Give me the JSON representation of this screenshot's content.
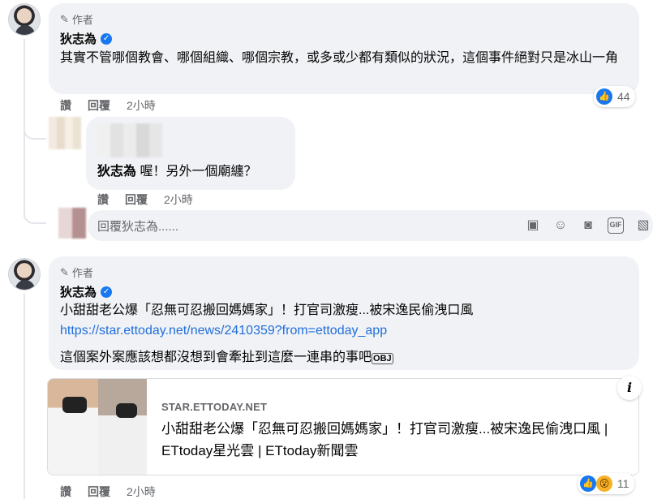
{
  "comment1": {
    "author_badge": "作者",
    "name": "狄志為",
    "text": "其實不管哪個教會、哪個組織、哪個宗教，或多或少都有類似的狀況，這個事件絕對只是冰山一角",
    "actions": {
      "like": "讚",
      "reply": "回覆",
      "time": "2小時"
    },
    "reaction_count": "44"
  },
  "reply1": {
    "mention": "狄志為",
    "text": "喔！另外一個廟纏？",
    "actions": {
      "like": "讚",
      "reply": "回覆",
      "time": "2小時"
    }
  },
  "reply_input": {
    "placeholder": "回覆狄志為......",
    "icons": [
      "sticker-icon",
      "emoji-icon",
      "camera-icon",
      "gif-icon",
      "sticker2-icon"
    ],
    "gif_label": "GIF"
  },
  "comment2": {
    "author_badge": "作者",
    "name": "狄志為",
    "headline": "小甜甜老公爆「忍無可忍搬回媽媽家」！打官司激瘦...被宋逸民偷洩口風",
    "url": "https://star.ettoday.net/news/2410359?from=ettoday_app",
    "text": "這個案外案應該想都沒想到會牽扯到這麼一連串的事吧",
    "tag": "OBJ",
    "preview": {
      "domain": "STAR.ETTODAY.NET",
      "title": "小甜甜老公爆「忍無可忍搬回媽媽家」！打官司激瘦...被宋逸民偷洩口風 | ETtoday星光雲 | ETtoday新聞雲"
    },
    "actions": {
      "like": "讚",
      "reply": "回覆",
      "time": "2小時"
    },
    "reaction_count": "11"
  },
  "colors": {
    "accent": "#1877f2",
    "bubble": "#f0f2f5",
    "link": "#216fdb",
    "muted": "#65676b"
  }
}
